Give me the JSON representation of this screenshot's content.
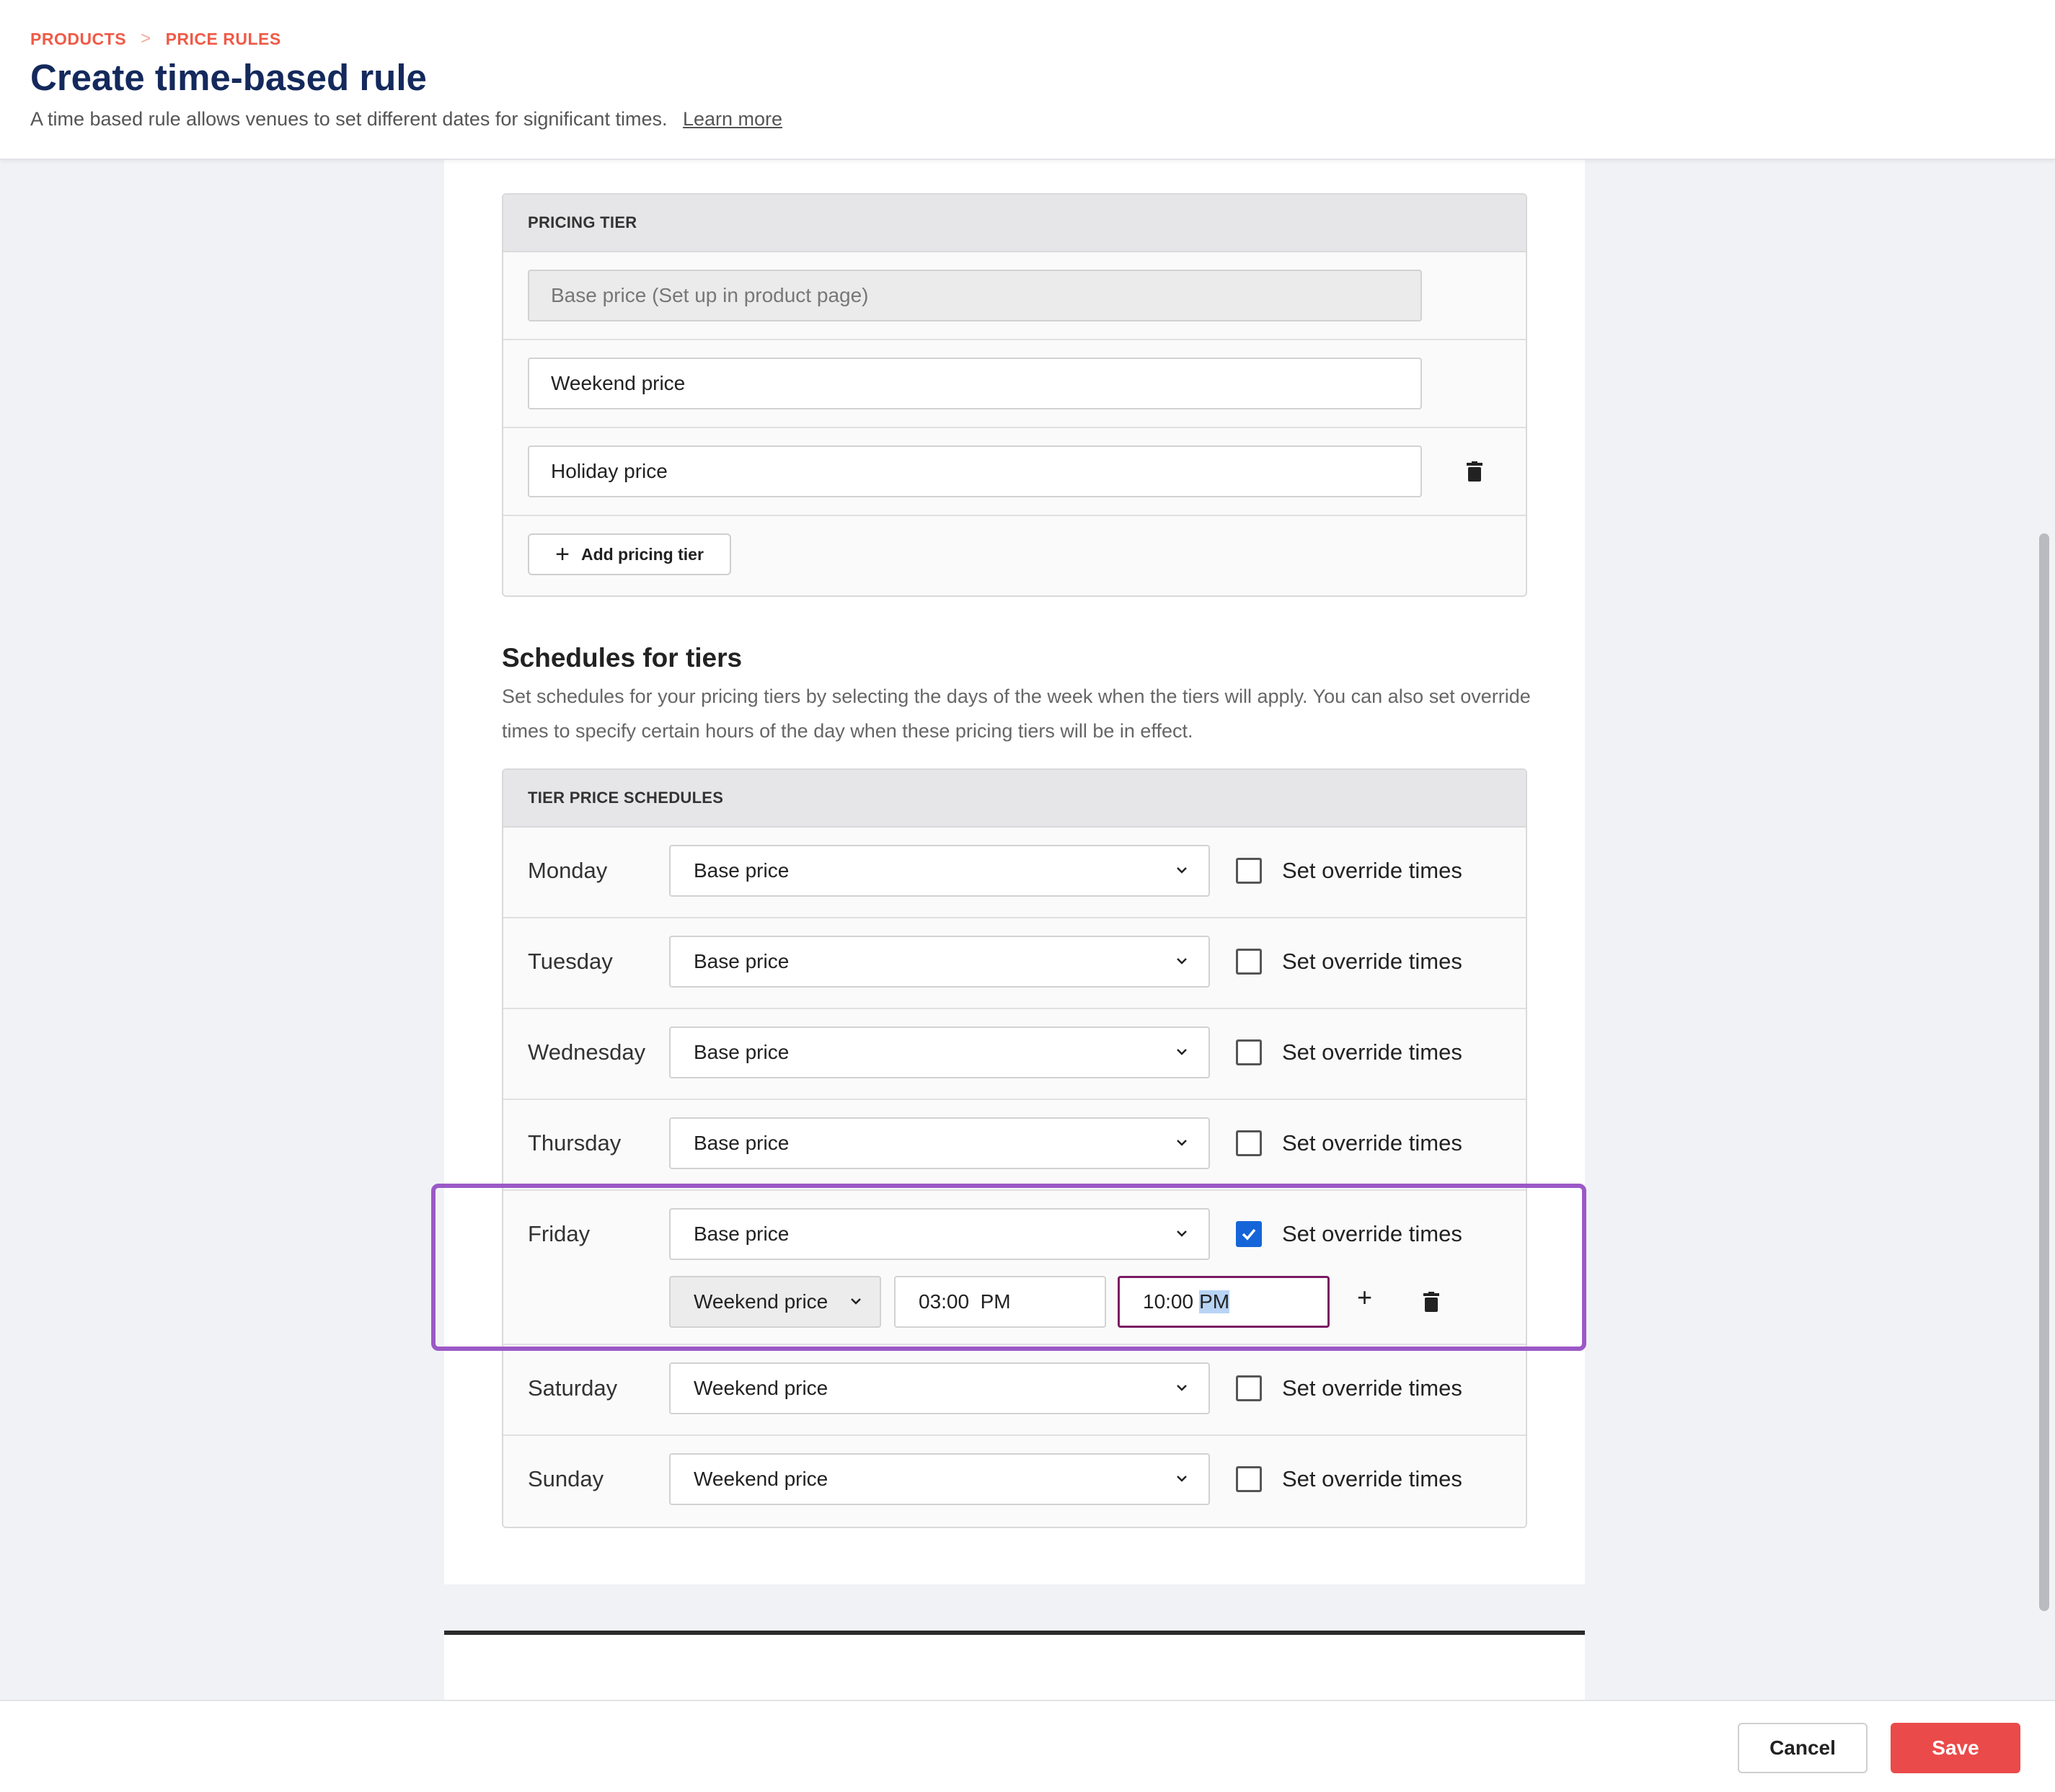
{
  "breadcrumb": {
    "items": [
      "PRODUCTS",
      "PRICE RULES"
    ],
    "separator": ">"
  },
  "page": {
    "title": "Create time-based rule",
    "subtitle": "A time based rule allows venues to set different dates for significant times.",
    "learn_more": "Learn more"
  },
  "pricing_tier": {
    "header": "PRICING TIER",
    "tiers": [
      {
        "value": "Base price (Set up in product page)",
        "disabled": true
      },
      {
        "value": "Weekend price",
        "disabled": false
      },
      {
        "value": "Holiday price",
        "disabled": false,
        "deletable": true
      }
    ],
    "add_label": "Add pricing tier"
  },
  "schedules": {
    "title": "Schedules for tiers",
    "description": "Set schedules for your pricing tiers by selecting the days of the week when the tiers will apply. You can also set override times to specify certain hours of the day when these pricing tiers will be in effect.",
    "header": "TIER PRICE SCHEDULES",
    "override_label": "Set override times",
    "days": [
      {
        "day": "Monday",
        "tier": "Base price",
        "override": false
      },
      {
        "day": "Tuesday",
        "tier": "Base price",
        "override": false
      },
      {
        "day": "Wednesday",
        "tier": "Base price",
        "override": false
      },
      {
        "day": "Thursday",
        "tier": "Base price",
        "override": false
      },
      {
        "day": "Friday",
        "tier": "Base price",
        "override": true
      },
      {
        "day": "Saturday",
        "tier": "Weekend price",
        "override": false
      },
      {
        "day": "Sunday",
        "tier": "Weekend price",
        "override": false
      }
    ],
    "friday_override": {
      "tier": "Weekend price",
      "start_time": "03:00  PM",
      "end_time_digits": "10:00",
      "end_time_meridiem": "PM",
      "add_symbol": "+"
    }
  },
  "footer": {
    "cancel_label": "Cancel",
    "save_label": "Save"
  },
  "colors": {
    "accent_red": "#ea4a4a",
    "breadcrumb": "#ef5a47",
    "title_navy": "#14295c",
    "checkbox_blue": "#1565d8",
    "highlight_purple": "#9b59c6",
    "focus_border": "#7a1c63"
  }
}
